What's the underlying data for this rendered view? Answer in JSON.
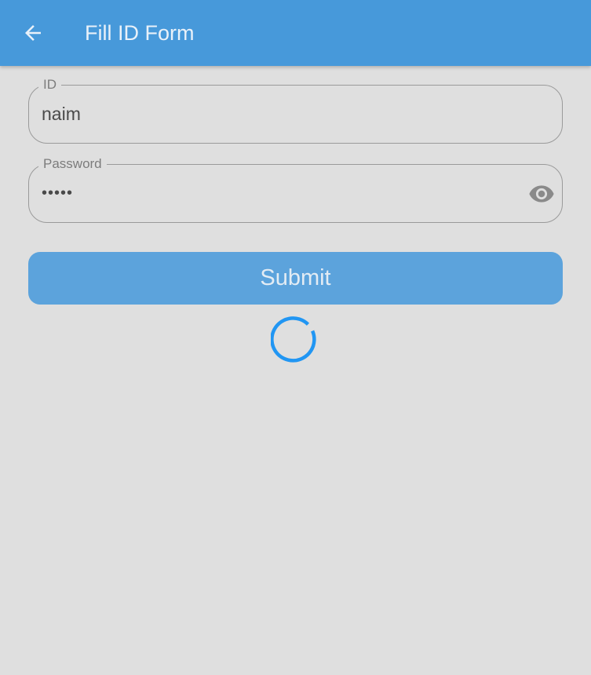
{
  "app_bar": {
    "title": "Fill ID Form",
    "back_icon": "arrow-back-icon",
    "background_color": "#4799da"
  },
  "form": {
    "id_field": {
      "label": "ID",
      "value": "naim"
    },
    "password_field": {
      "label": "Password",
      "value": "•••••",
      "visibility_icon": "eye-icon"
    },
    "submit": {
      "label": "Submit",
      "color": "#5ca3dc"
    }
  },
  "loading": {
    "indicator": "circular-progress-spinner",
    "color": "#2196f3"
  }
}
